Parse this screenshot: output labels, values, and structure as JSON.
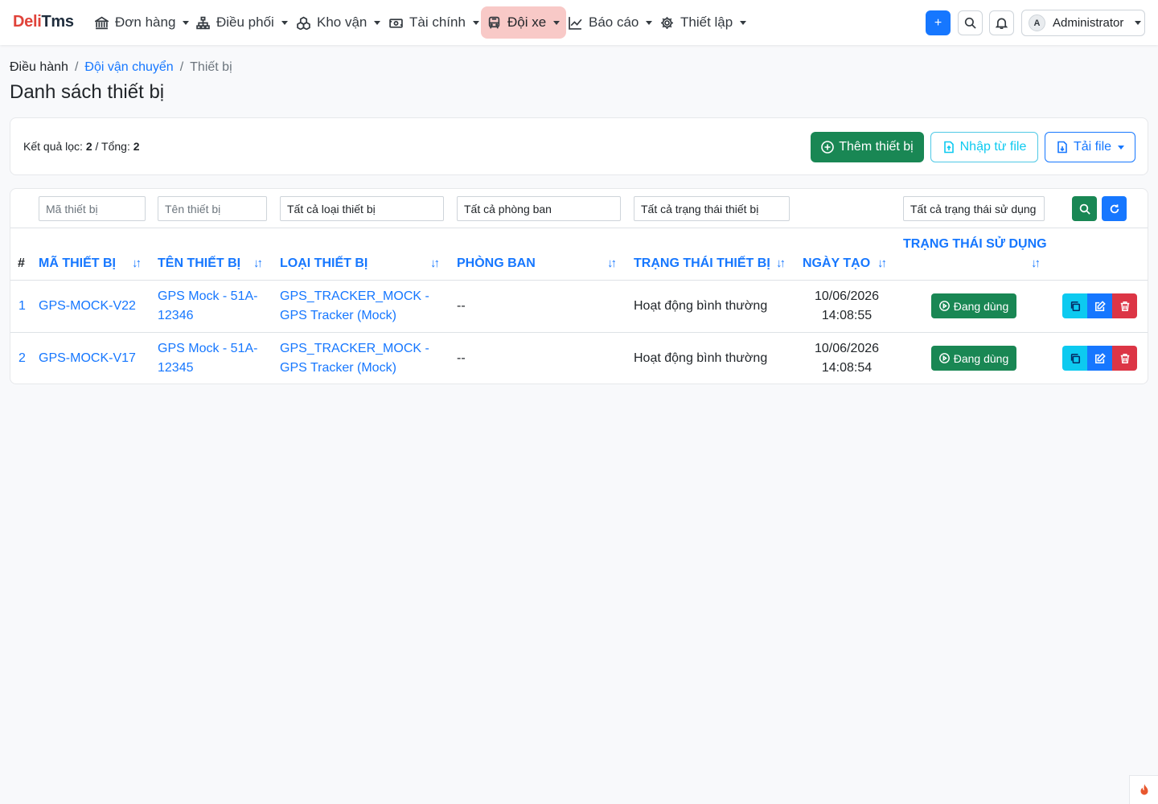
{
  "brand": {
    "part1": "Deli",
    "part2": "Tms"
  },
  "nav": {
    "items": [
      {
        "label": "Đơn hàng",
        "icon": "bank-icon"
      },
      {
        "label": "Điều phối",
        "icon": "diagram-icon"
      },
      {
        "label": "Kho vận",
        "icon": "boxes-icon"
      },
      {
        "label": "Tài chính",
        "icon": "cash-icon"
      },
      {
        "label": "Đội xe",
        "icon": "bus-icon"
      },
      {
        "label": "Báo cáo",
        "icon": "chart-icon"
      },
      {
        "label": "Thiết lập",
        "icon": "gear-icon"
      }
    ],
    "active_index": 4,
    "plus_label": "+",
    "user": {
      "initial": "A",
      "name": "Administrator"
    }
  },
  "breadcrumb": {
    "home": "Điều hành",
    "parent": "Đội vận chuyển",
    "current": "Thiết bị",
    "separator": "/"
  },
  "page": {
    "title": "Danh sách thiết bị"
  },
  "results": {
    "filtered_label": "Kết quả lọc:",
    "filtered": "2",
    "sep": "/",
    "total_label": "Tổng:",
    "total": "2"
  },
  "actions": {
    "add_label": "Thêm thiết bị",
    "import_label": "Nhập từ file",
    "download_label": "Tải file"
  },
  "filters": {
    "code_placeholder": "Mã thiết bị",
    "name_placeholder": "Tên thiết bị",
    "type_value": "Tất cả loại thiết bị",
    "dept_value": "Tất cả phòng ban",
    "status_value": "Tất cả trạng thái thiết bị",
    "usage_value": "Tất cả trạng thái sử dụng"
  },
  "table": {
    "headers": {
      "index": "#",
      "code": "MÃ THIẾT BỊ",
      "name": "TÊN THIẾT BỊ",
      "type": "LOẠI THIẾT BỊ",
      "dept": "PHÒNG BAN",
      "status": "TRẠNG THÁI THIẾT BỊ",
      "created": "NGÀY TẠO",
      "usage": "TRẠNG THÁI SỬ DỤNG"
    },
    "sort_glyph": "↓↑",
    "rows": [
      {
        "index": "1",
        "code": "GPS-MOCK-V22",
        "name_line1": "GPS Mock - 51A-",
        "name_line2": "12346",
        "type_line1": "GPS_TRACKER_MOCK -",
        "type_line2": "GPS Tracker (Mock)",
        "dept": "--",
        "status": "Hoạt động bình thường",
        "date": "10/06/2026",
        "time": "14:08:55",
        "usage": "Đang dùng"
      },
      {
        "index": "2",
        "code": "GPS-MOCK-V17",
        "name_line1": "GPS Mock - 51A-",
        "name_line2": "12345",
        "type_line1": "GPS_TRACKER_MOCK -",
        "type_line2": "GPS Tracker (Mock)",
        "dept": "--",
        "status": "Hoạt động bình thường",
        "date": "10/06/2026",
        "time": "14:08:54",
        "usage": "Đang dùng"
      }
    ]
  },
  "colors": {
    "primary": "#1677ff",
    "success": "#198754",
    "info": "#0dcaf0",
    "danger": "#dc3545",
    "brand_red": "#e0433a",
    "active_nav": "#f8c9c7"
  }
}
